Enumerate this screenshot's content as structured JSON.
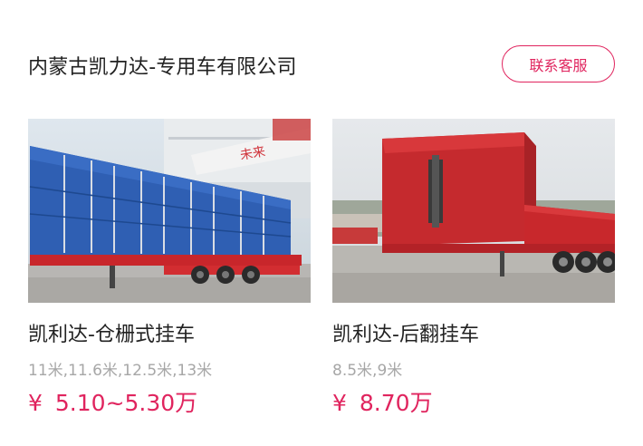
{
  "header": {
    "company_name": "内蒙古凯力达-专用车有限公司",
    "contact_label": "联系客服"
  },
  "products": [
    {
      "title": "凯利达-仓栅式挂车",
      "specs": "11米,11.6米,12.5米,13米",
      "currency": "¥",
      "price": "5.10~5.30万",
      "image_icon": "stake-fence-semi-trailer-photo"
    },
    {
      "title": "凯利达-后翻挂车",
      "specs": "8.5米,9米",
      "currency": "¥",
      "price": "8.70万",
      "image_icon": "rear-dump-semi-trailer-photo"
    }
  ],
  "colors": {
    "accent": "#e0245e",
    "text_primary": "#222222",
    "text_secondary": "#a7a7a7"
  }
}
